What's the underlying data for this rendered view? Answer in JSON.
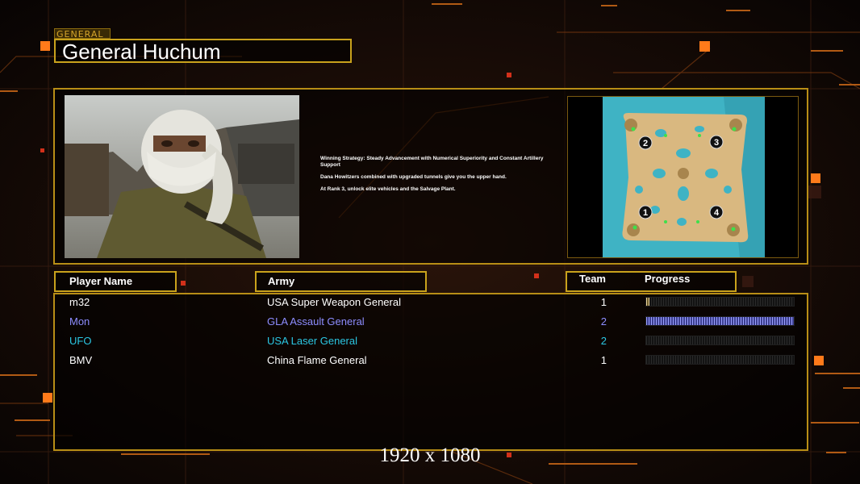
{
  "header": {
    "tag": "GENERAL",
    "title": "General Huchum"
  },
  "info": {
    "strategy_lines": [
      "Winning Strategy: Steady Advancement with Numerical Superiority and Constant Artillery Support",
      "Dana Howitzers combined with upgraded tunnels give you the upper hand.",
      "At Rank 3, unlock elite vehicles and the Salvage Plant."
    ],
    "map_start_positions": [
      "1",
      "2",
      "3",
      "4"
    ]
  },
  "columns": {
    "player_name": "Player Name",
    "army": "Army",
    "team": "Team",
    "progress": "Progress"
  },
  "players": [
    {
      "name": "m32",
      "army": "USA Super Weapon General",
      "team": "1",
      "color": "#ffffff",
      "progress": 0.02
    },
    {
      "name": "Mon",
      "army": "GLA Assault General",
      "team": "2",
      "color": "#8d8dff",
      "progress": 1.0
    },
    {
      "name": "UFO",
      "army": "USA Laser General",
      "team": "2",
      "color": "#2bc7e3",
      "progress": 0
    },
    {
      "name": "BMV",
      "army": "China Flame General",
      "team": "1",
      "color": "#ffffff",
      "progress": 0
    }
  ],
  "footer": {
    "resolution": "1920 x 1080"
  },
  "colors": {
    "gold_border": "#c9a21c",
    "background": "#0d0704",
    "accent_orange": "#ff7a1a"
  }
}
